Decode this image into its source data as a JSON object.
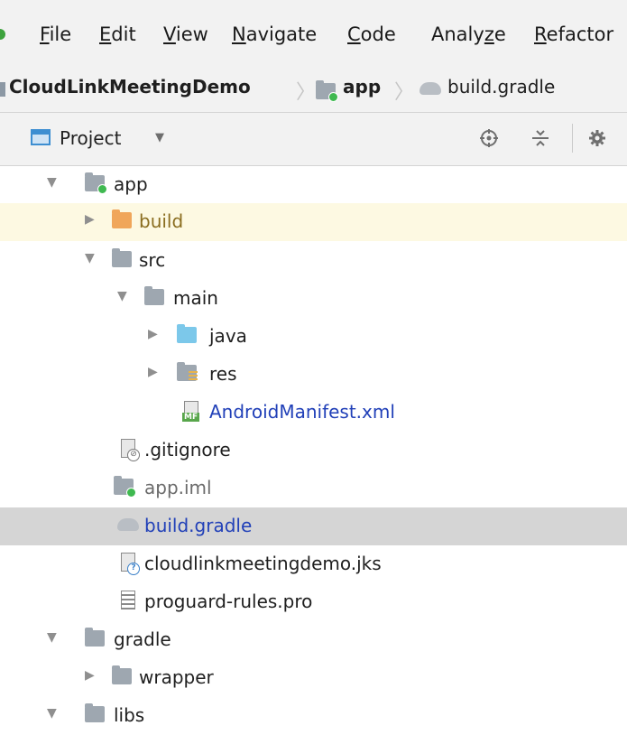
{
  "menu": {
    "items": [
      {
        "mnemonic": "F",
        "rest": "ile"
      },
      {
        "mnemonic": "E",
        "rest": "dit"
      },
      {
        "mnemonic": "V",
        "rest": "iew"
      },
      {
        "mnemonic": "N",
        "rest": "avigate"
      },
      {
        "mnemonic": "C",
        "rest": "ode"
      },
      {
        "pre": "Analy",
        "mnemonic": "z",
        "rest": "e"
      },
      {
        "mnemonic": "R",
        "rest": "efactor"
      }
    ]
  },
  "breadcrumb": {
    "items": [
      "CloudLinkMeetingDemo",
      "app",
      "build.gradle"
    ],
    "separator": "〉"
  },
  "project_panel": {
    "title": "Project",
    "caret": "▼"
  },
  "tree": {
    "rows": [
      {
        "label": "app",
        "expanded": true
      },
      {
        "label": "build",
        "expanded": false
      },
      {
        "label": "src",
        "expanded": true
      },
      {
        "label": "main",
        "expanded": true
      },
      {
        "label": "java",
        "expanded": false
      },
      {
        "label": "res",
        "expanded": false
      },
      {
        "label": "AndroidManifest.xml"
      },
      {
        "label": ".gitignore"
      },
      {
        "label": "app.iml"
      },
      {
        "label": "build.gradle"
      },
      {
        "label": "cloudlinkmeetingdemo.jks"
      },
      {
        "label": "proguard-rules.pro"
      },
      {
        "label": "gradle",
        "expanded": true
      },
      {
        "label": "wrapper",
        "expanded": false
      },
      {
        "label": "libs",
        "expanded": true
      }
    ]
  },
  "icons": {
    "expanded_arrow": "▼",
    "collapsed_arrow": "▶",
    "manifest_tag": "MF",
    "ignore_badge": "⊘",
    "unknown_badge": "?"
  },
  "colors": {
    "selected_row": "#d5d5d5",
    "highlight_row": "#fdf9e2",
    "link_text": "#2140b8"
  }
}
